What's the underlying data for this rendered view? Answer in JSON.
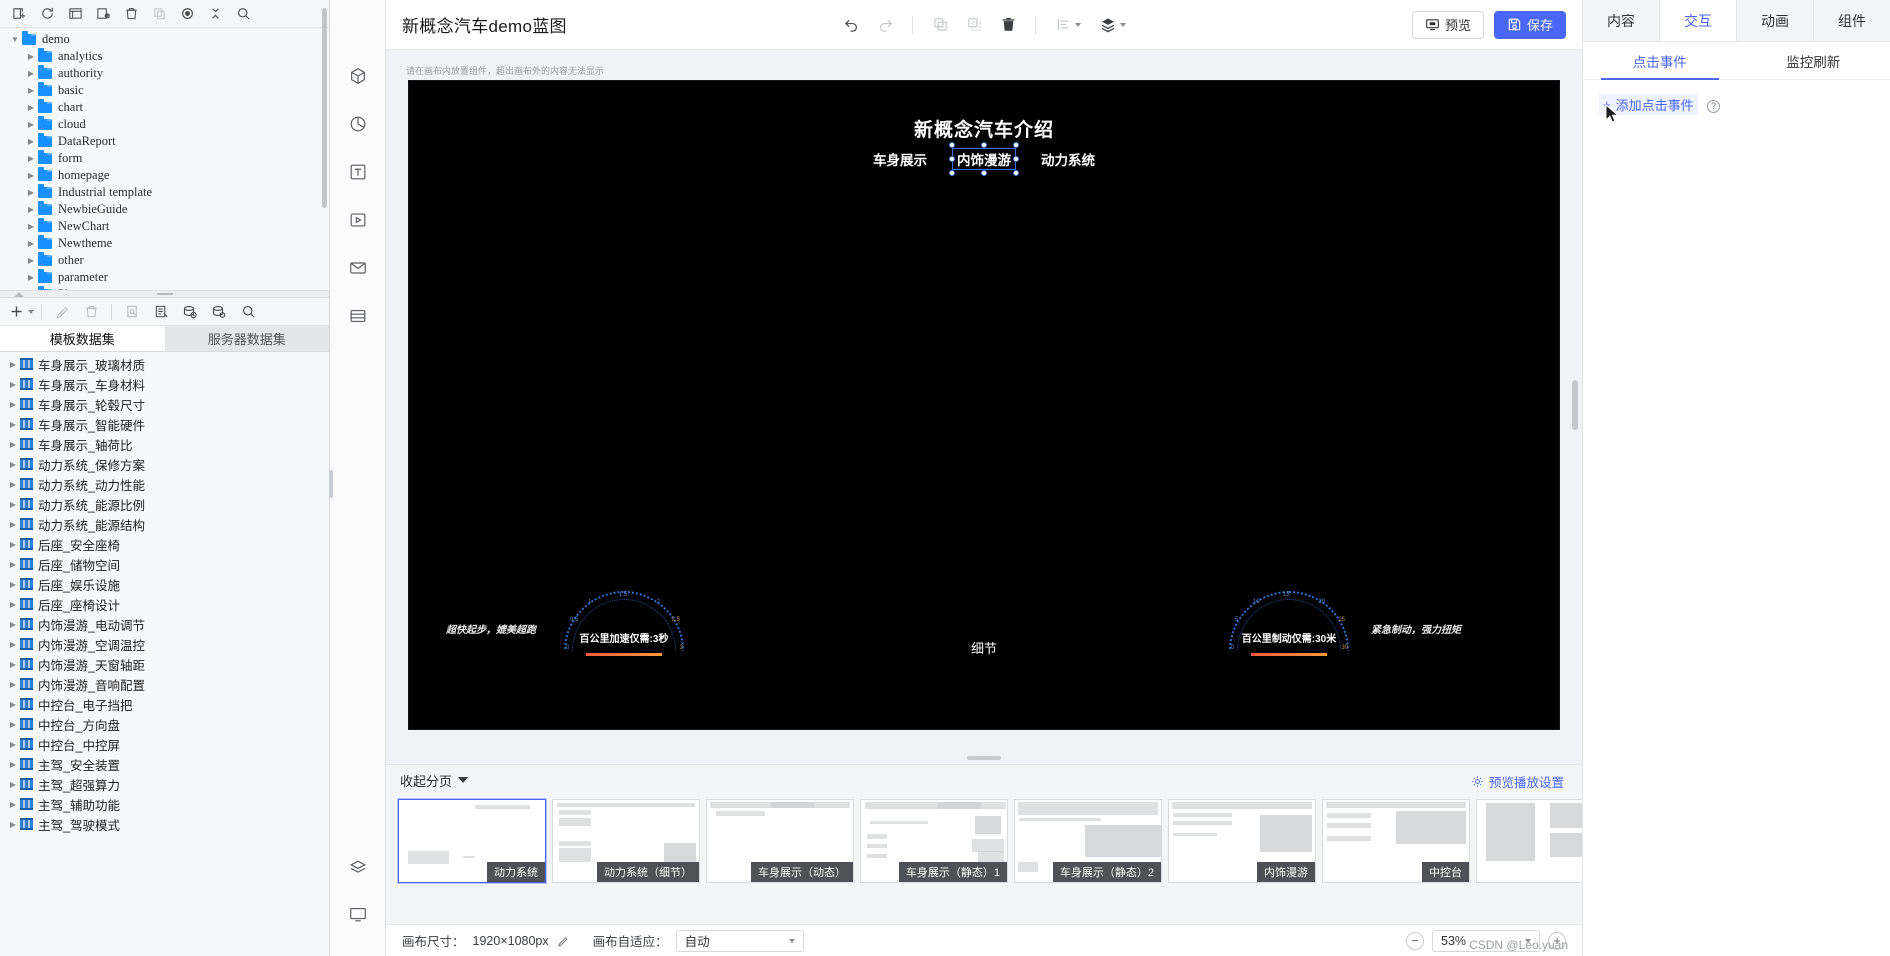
{
  "left_panel": {
    "tree_toolbar": [
      {
        "name": "new-folder-icon",
        "title": "新建"
      },
      {
        "name": "refresh-icon",
        "title": "刷新"
      },
      {
        "name": "rename-icon",
        "title": "重命名"
      },
      {
        "name": "edit-properties-icon",
        "title": "属性"
      },
      {
        "name": "delete-icon",
        "title": "删除"
      },
      {
        "name": "copy-icon",
        "title": "复制"
      },
      {
        "name": "locate-icon",
        "title": "定位"
      },
      {
        "name": "collapse-all-icon",
        "title": "收起"
      },
      {
        "name": "search-icon",
        "title": "搜索"
      }
    ],
    "tree": [
      {
        "label": "demo",
        "depth": 0,
        "expanded": true
      },
      {
        "label": "analytics",
        "depth": 1,
        "expanded": false
      },
      {
        "label": "authority",
        "depth": 1,
        "expanded": false
      },
      {
        "label": "basic",
        "depth": 1,
        "expanded": false
      },
      {
        "label": "chart",
        "depth": 1,
        "expanded": false
      },
      {
        "label": "cloud",
        "depth": 1,
        "expanded": false
      },
      {
        "label": "DataReport",
        "depth": 1,
        "expanded": false
      },
      {
        "label": "form",
        "depth": 1,
        "expanded": false
      },
      {
        "label": "homepage",
        "depth": 1,
        "expanded": false
      },
      {
        "label": "Industrial template",
        "depth": 1,
        "expanded": false
      },
      {
        "label": "NewbieGuide",
        "depth": 1,
        "expanded": false
      },
      {
        "label": "NewChart",
        "depth": 1,
        "expanded": false
      },
      {
        "label": "Newtheme",
        "depth": 1,
        "expanded": false
      },
      {
        "label": "other",
        "depth": 1,
        "expanded": false
      },
      {
        "label": "parameter",
        "depth": 1,
        "expanded": false
      },
      {
        "label": "Phone",
        "depth": 1,
        "expanded": false
      }
    ],
    "ds_toolbar": [
      {
        "name": "add-dataset-icon",
        "title": "新增"
      },
      {
        "name": "edit-dataset-icon",
        "title": "编辑"
      },
      {
        "name": "delete-dataset-icon",
        "title": "删除"
      },
      {
        "name": "preview-dataset-icon",
        "title": "预览"
      },
      {
        "name": "edit-sql-icon",
        "title": "编辑SQL"
      },
      {
        "name": "db-history-icon",
        "title": "历史"
      },
      {
        "name": "db-settings-icon",
        "title": "设置"
      },
      {
        "name": "search-dataset-icon",
        "title": "搜索"
      }
    ],
    "ds_tabs": [
      {
        "label": "模板数据集",
        "active": true
      },
      {
        "label": "服务器数据集",
        "active": false
      }
    ],
    "datasets": [
      "车身展示_玻璃材质",
      "车身展示_车身材料",
      "车身展示_轮毂尺寸",
      "车身展示_智能硬件",
      "车身展示_轴荷比",
      "动力系统_保修方案",
      "动力系统_动力性能",
      "动力系统_能源比例",
      "动力系统_能源结构",
      "后座_安全座椅",
      "后座_储物空间",
      "后座_娱乐设施",
      "后座_座椅设计",
      "内饰漫游_电动调节",
      "内饰漫游_空调温控",
      "内饰漫游_天窗轴距",
      "内饰漫游_音响配置",
      "中控台_电子挡把",
      "中控台_方向盘",
      "中控台_中控屏",
      "主驾_安全装置",
      "主驾_超强算力",
      "主驾_辅助功能",
      "主驾_驾驶模式"
    ]
  },
  "rail": {
    "items": [
      {
        "name": "components-icon",
        "title": "组件"
      },
      {
        "name": "chart-icon",
        "title": "图表"
      },
      {
        "name": "text-icon",
        "title": "文本"
      },
      {
        "name": "media-icon",
        "title": "媒体"
      },
      {
        "name": "material-icon",
        "title": "素材"
      },
      {
        "name": "table-icon",
        "title": "表格"
      }
    ],
    "bottom": [
      {
        "name": "layers-icon",
        "title": "图层"
      },
      {
        "name": "screen-icon",
        "title": "屏幕"
      }
    ]
  },
  "topbar": {
    "title": "新概念汽车demo蓝图",
    "tools": [
      {
        "name": "undo-icon",
        "label": "撤销",
        "disabled": false
      },
      {
        "name": "redo-icon",
        "label": "重做",
        "disabled": true
      },
      {
        "name": "copy-icon",
        "label": "复制",
        "disabled": true
      },
      {
        "name": "paste-icon",
        "label": "粘贴",
        "disabled": true
      },
      {
        "name": "delete-icon",
        "label": "删除",
        "disabled": false
      },
      {
        "name": "align-icon",
        "label": "对齐",
        "disabled": true
      },
      {
        "name": "layer-order-icon",
        "label": "层级",
        "disabled": false
      }
    ],
    "preview_label": "预览",
    "save_label": "保存"
  },
  "stage": {
    "hint": "请在画布内放置组件，超出画布外的内容无法显示",
    "canvas": {
      "title": "新概念汽车介绍",
      "nav": [
        {
          "label": "车身展示",
          "selected": false
        },
        {
          "label": "内饰漫游",
          "selected": true
        },
        {
          "label": "动力系统",
          "selected": false
        }
      ],
      "center_label": "细节",
      "left_gauge": {
        "slogan": "超快起步，媲美超跑",
        "value_text": "百公里加速仅需:3秒",
        "ticks": [
          "0",
          "0.5",
          "1",
          "1.5",
          "2",
          "2.5",
          "3"
        ]
      },
      "right_gauge": {
        "slogan": "紧急制动，强力扭矩",
        "value_text": "百公里制动仅需:30米",
        "ticks": [
          "0",
          "5",
          "10",
          "15",
          "20",
          "25",
          "30"
        ]
      }
    }
  },
  "pages": {
    "collapse_label": "收起分页",
    "preview_play_label": "预览播放设置",
    "thumbnails": [
      {
        "label": "动力系统",
        "active": true
      },
      {
        "label": "动力系统（细节）",
        "active": false
      },
      {
        "label": "车身展示（动态）",
        "active": false
      },
      {
        "label": "车身展示（静态）1",
        "active": false
      },
      {
        "label": "车身展示（静态）2",
        "active": false
      },
      {
        "label": "内饰漫游",
        "active": false
      },
      {
        "label": "中控台",
        "active": false
      },
      {
        "label": "",
        "active": false
      }
    ]
  },
  "bottombar": {
    "canvas_size_label": "画布尺寸：",
    "canvas_size_value": "1920×1080px",
    "fit_label": "画布自适应：",
    "fit_value": "自动",
    "zoom_value": "53%",
    "watermark": "CSDN @Leo.yuan"
  },
  "right_panel": {
    "tabs": [
      {
        "label": "内容",
        "active": false
      },
      {
        "label": "交互",
        "active": true
      },
      {
        "label": "动画",
        "active": false
      },
      {
        "label": "组件",
        "active": false
      }
    ],
    "subtabs": [
      {
        "label": "点击事件",
        "active": true
      },
      {
        "label": "监控刷新",
        "active": false
      }
    ],
    "add_event_label": "添加点击事件",
    "help_glyph": "?"
  },
  "colors": {
    "accent": "#4a66f5",
    "folder": "#1890ff",
    "canvas_bg": "#000000",
    "gauge_blue": "#2f6fd0",
    "gauge_orange": "#ff8a3c"
  }
}
